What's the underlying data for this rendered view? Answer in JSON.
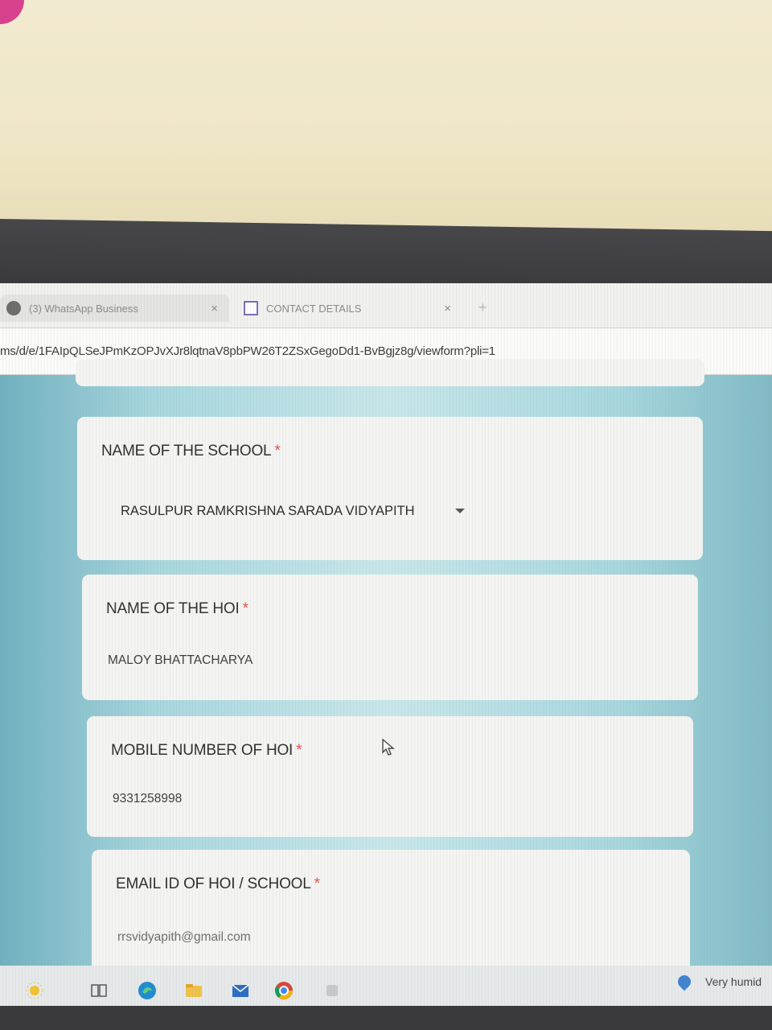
{
  "browser": {
    "tabs": [
      {
        "label": "(3) WhatsApp Business",
        "icon": "whatsapp-icon",
        "close": "×"
      },
      {
        "label": "CONTACT DETAILS",
        "icon": "google-forms-icon",
        "close": "×"
      }
    ],
    "new_tab": "+",
    "url": "ms/d/e/1FAIpQLSeJPmKzOPJvXJr8lqtnaV8pbPW26T2ZSxGegoDd1-BvBgjz8g/viewform?pli=1"
  },
  "form": {
    "questions": [
      {
        "title": "NAME OF THE SCHOOL",
        "required": "*",
        "answer": "RASULPUR RAMKRISHNA SARADA VIDYAPITH",
        "type": "dropdown"
      },
      {
        "title": "NAME OF THE HOI",
        "required": "*",
        "answer": "MALOY BHATTACHARYA",
        "type": "text"
      },
      {
        "title": "MOBILE NUMBER OF HOI",
        "required": "*",
        "answer": "9331258998",
        "type": "text"
      },
      {
        "title": "EMAIL ID OF HOI / SCHOOL",
        "required": "*",
        "answer": "rrsvidyapith@gmail.com",
        "type": "text"
      }
    ]
  },
  "taskbar": {
    "icons": [
      "widgets-icon",
      "task-view-icon",
      "edge-icon",
      "file-explorer-icon",
      "mail-icon",
      "chrome-icon",
      "app-icon"
    ],
    "weather": "Very humid"
  },
  "colors": {
    "form_background": "#a7d7de",
    "required_star": "#e0524d",
    "card": "#f4f4f2"
  }
}
